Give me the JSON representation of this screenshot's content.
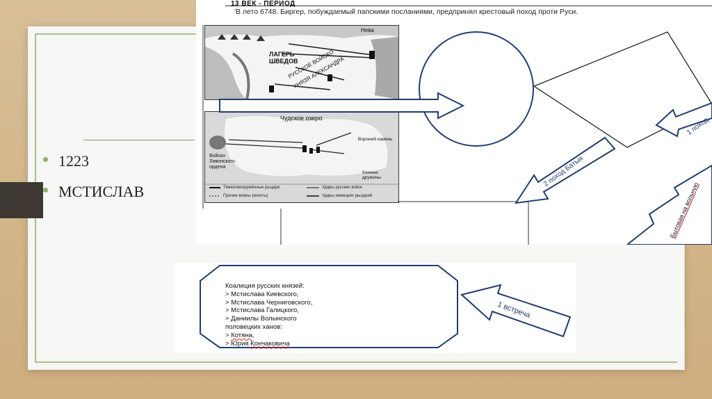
{
  "slide": {
    "bullets": [
      {
        "text": "1223"
      },
      {
        "text": "МСТИСЛАВ"
      }
    ]
  },
  "scan": {
    "header_title": "13 ВЕК - ПЕРИОД",
    "header_text": "'В лето 6748. Биргер, побуждаемый папскими посланиями, предпринял крестовый поход проти Руси.",
    "map1": {
      "labels": {
        "neva": "Нева",
        "lager": "ЛАГЕРЬ",
        "shvedov": "ШВЕДОВ",
        "army": "РУССКОЕ ВОЙСКО",
        "prince": "КНЯЗЯ АЛЕКСАНДРА"
      }
    },
    "map2": {
      "labels": {
        "lake": "Чудское озеро",
        "livonian": "Войско Ливонского ордена",
        "vorony": "Вороний камень",
        "podrobnosti": "Конные дружины"
      },
      "legend": [
        {
          "text": "Тяжеловооружённые рыцари"
        },
        {
          "text": "Удары русских войск"
        },
        {
          "text": "Прочие воины (кнехты)"
        },
        {
          "text": "Удары немецких рыцарей"
        },
        {
          "text": "Конные дружины"
        }
      ]
    },
    "arrows": {
      "pohod2": "2 поход Батыя",
      "pohod1": "1 поход",
      "side_text": "Бытовая на вольную"
    },
    "coalition": {
      "lines": [
        {
          "text": "Коалиция  русских князей:"
        },
        {
          "text": "> Мстислава Киевского,"
        },
        {
          "text": "> Мстислава Черниговского,"
        },
        {
          "text": "> Мстислава Галицкого,"
        },
        {
          "text": "> Даниилы Волынского"
        },
        {
          "text": "половецких ханов:"
        },
        {
          "prefix": "> ",
          "text": "Котяна",
          "suffix": ","
        },
        {
          "prefix": "> Юрия ",
          "text": "Кончаковича",
          "suffix": ""
        }
      ]
    },
    "meeting_arrow": "1 встреча"
  }
}
